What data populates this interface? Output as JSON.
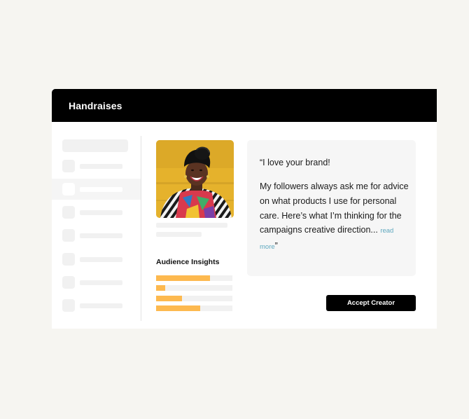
{
  "header": {
    "title": "Handraises"
  },
  "profile": {
    "insights_title": "Audience Insights",
    "audience_bars": [
      0.71,
      0.12,
      0.34,
      0.58
    ]
  },
  "message": {
    "open_quote": "“",
    "greeting": "I love your brand!",
    "body": "My followers always ask me for advice on what products I use for personal care. Here’s what I’m thinking for the campaigns creative direction...",
    "read_more": "read more",
    "close_quote": "”"
  },
  "actions": {
    "accept_label": "Accept Creator"
  },
  "colors": {
    "page_bg": "#f6f5f1",
    "header_bg": "#000000",
    "bar_fill": "#fdb94f",
    "read_more": "#5fa8bf"
  },
  "icons": {
    "photo": "creator-avatar-photo"
  }
}
